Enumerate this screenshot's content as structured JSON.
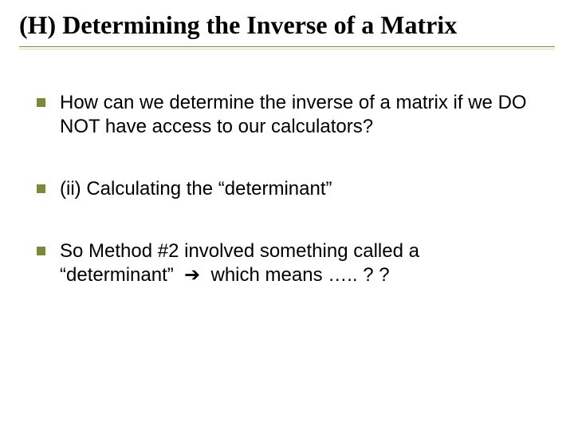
{
  "title": "(H) Determining the Inverse of a Matrix",
  "bullets": [
    {
      "text": "How can we determine the inverse of a matrix if we DO NOT have access to our calculators?"
    },
    {
      "text": "(ii) Calculating the “determinant”"
    },
    {
      "text": "So Method #2 involved something called a “determinant”  ➔  which means ….. ? ?"
    }
  ]
}
